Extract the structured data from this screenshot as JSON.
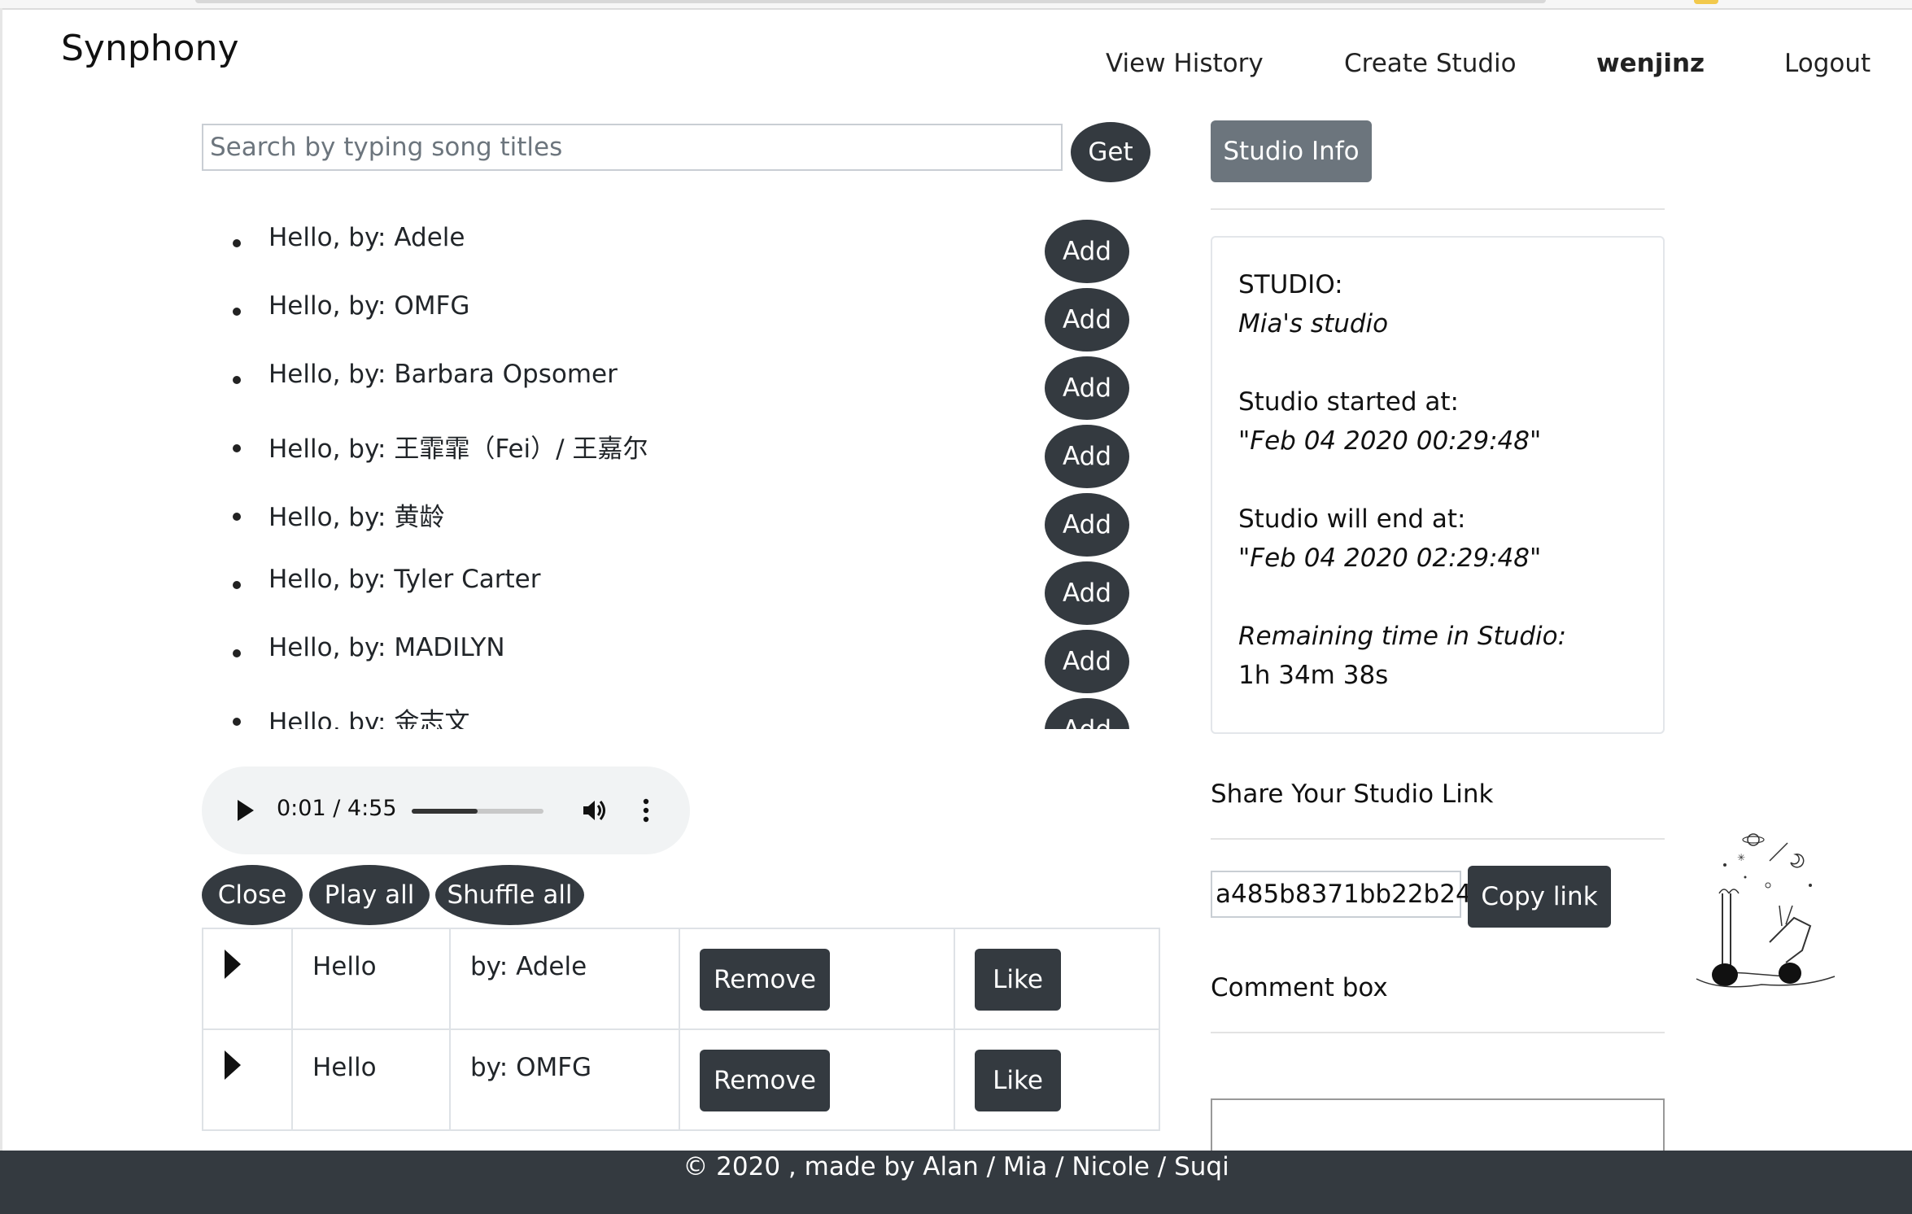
{
  "brand": "Synphony",
  "nav": {
    "view_history": "View History",
    "create_studio": "Create Studio",
    "user": "wenjinz",
    "logout": "Logout"
  },
  "search": {
    "placeholder": "Search by typing song titles",
    "button": "Get"
  },
  "results": {
    "add_label": "Add",
    "items": [
      "Hello, by: Adele",
      "Hello, by: OMFG",
      "Hello, by: Barbara Opsomer",
      "Hello, by: 王霏霏（Fei）/ 王嘉尔",
      "Hello, by: 黄龄",
      "Hello, by: Tyler Carter",
      "Hello, by: MADILYN",
      "Hello, by: 金志文"
    ]
  },
  "player": {
    "time": "0:01 / 4:55",
    "progress_fraction": 0.5
  },
  "controls": {
    "close": "Close",
    "play_all": "Play all",
    "shuffle_all": "Shuffle all"
  },
  "queue": [
    {
      "title": "Hello",
      "artist": "by: Adele",
      "remove": "Remove",
      "like": "Like"
    },
    {
      "title": "Hello",
      "artist": "by: OMFG",
      "remove": "Remove",
      "like": "Like"
    }
  ],
  "studio": {
    "button": "Studio Info",
    "name_label": "STUDIO:",
    "name": "Mia's studio",
    "started_label": "Studio started at:",
    "started": "\"Feb 04 2020 00:29:48\"",
    "end_label": "Studio will end at:",
    "end": "\"Feb 04 2020 02:29:48\"",
    "remaining_label": "Remaining time in Studio:",
    "remaining": "1h 34m 38s"
  },
  "share": {
    "title": "Share Your Studio Link",
    "link": "a485b8371bb22b24",
    "copy": "Copy link"
  },
  "comment": {
    "title": "Comment box"
  },
  "footer": "© 2020 , made by Alan / Mia / Nicole / Suqi"
}
